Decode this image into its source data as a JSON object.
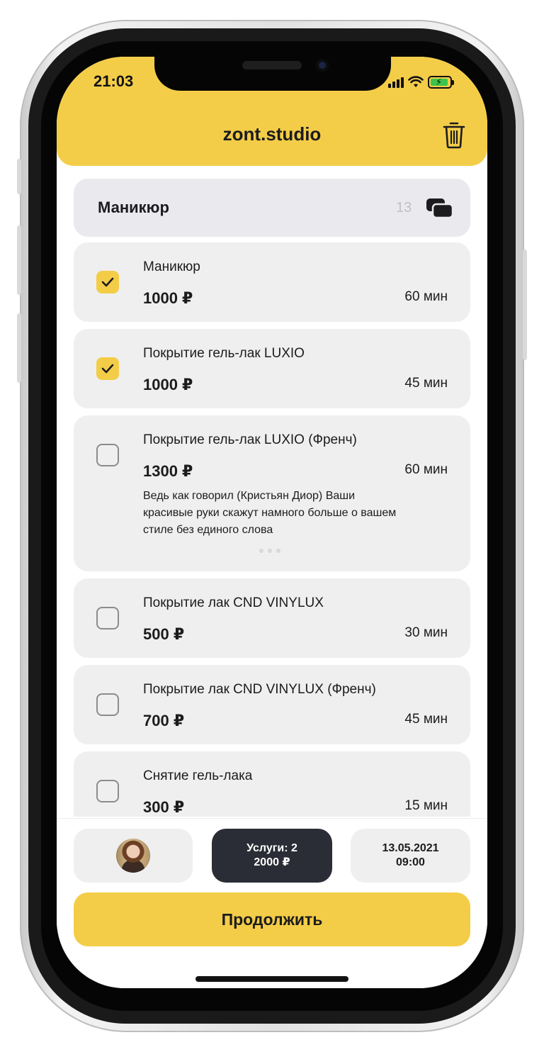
{
  "status_bar": {
    "time": "21:03"
  },
  "header": {
    "title": "zont.studio"
  },
  "category": {
    "title": "Маникюр",
    "count": "13"
  },
  "services": [
    {
      "name": "Маникюр",
      "price": "1000 ₽",
      "duration": "60 мин",
      "checked": true
    },
    {
      "name": "Покрытие гель-лак LUXIO",
      "price": "1000 ₽",
      "duration": "45 мин",
      "checked": true
    },
    {
      "name": "Покрытие гель-лак LUXIO (Френч)",
      "price": "1300 ₽",
      "duration": "60 мин",
      "checked": false,
      "description": [
        "Ведь как говорил (Кристьян Диор) Ваши",
        "красивые руки скажут намного больше о вашем",
        "стиле без единого слова"
      ]
    },
    {
      "name": "Покрытие лак CND VINYLUX",
      "price": "500 ₽",
      "duration": "30 мин",
      "checked": false
    },
    {
      "name": "Покрытие лак CND VINYLUX (Френч)",
      "price": "700 ₽",
      "duration": "45 мин",
      "checked": false
    },
    {
      "name": "Снятие гель-лака",
      "price": "300 ₽",
      "duration": "15 мин",
      "checked": false
    }
  ],
  "summary": {
    "services_line": "Услуги: 2",
    "total_line": "2000 ₽",
    "date": "13.05.2021",
    "time": "09:00"
  },
  "continue_label": "Продолжить",
  "colors": {
    "accent": "#f4cd48",
    "dark_chip": "#2b2d36",
    "card": "#efefef"
  }
}
